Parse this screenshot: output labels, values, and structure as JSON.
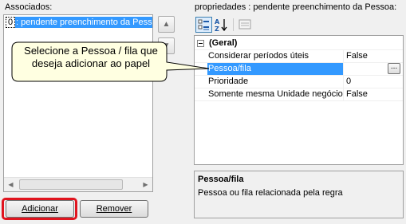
{
  "left_panel": {
    "label": "Associados:",
    "items": [
      {
        "index": "0",
        "text": ": pendente preenchimento da Pessoa"
      }
    ],
    "scroll_left": "◀",
    "scroll_right": "▶"
  },
  "move_up_icon": "▲",
  "move_down_icon": "▼",
  "buttons": {
    "add": "Adicionar",
    "remove": "Remover"
  },
  "callout": {
    "line1": "Selecione a Pessoa / fila que",
    "line2": "deseja adicionar ao papel"
  },
  "properties": {
    "label": "propriedades : pendente preenchimento da Pessoa:",
    "category": "(Geral)",
    "rows": [
      {
        "name": "Considerar períodos úteis",
        "value": "False"
      },
      {
        "name": "Pessoa/fila",
        "value": "",
        "button": "..."
      },
      {
        "name": "Prioridade",
        "value": "0"
      },
      {
        "name": "Somente mesma Unidade negócio",
        "value": "False"
      }
    ],
    "help_title": "Pessoa/fila",
    "help_description": "Pessoa ou fila relacionada pela regra"
  },
  "colors": {
    "selection": "#3399ff",
    "highlight": "#e0141e",
    "callout_fill": "#ffffe1"
  }
}
